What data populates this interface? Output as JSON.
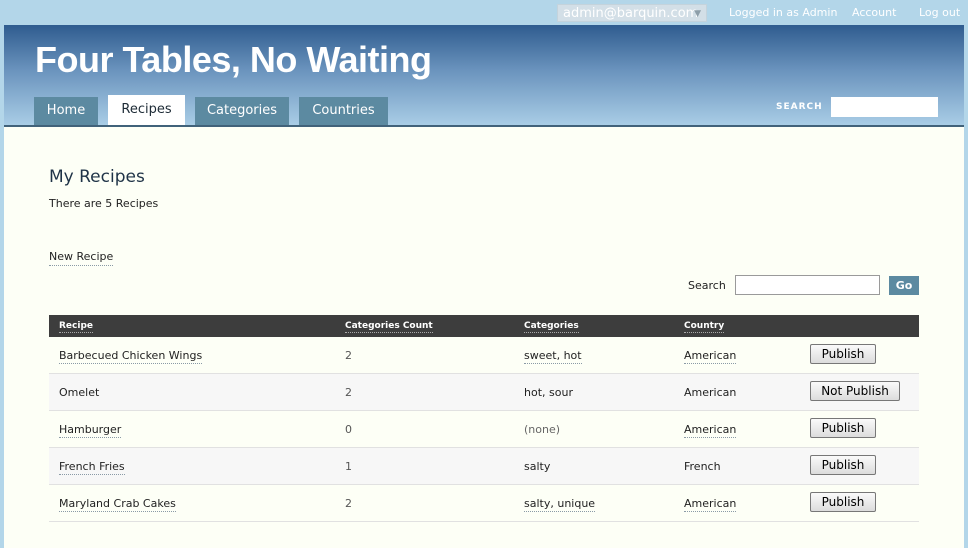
{
  "topbar": {
    "user_email": "admin@barquin.com",
    "status": "Logged in as Admin",
    "account": "Account",
    "logout": "Log out"
  },
  "header": {
    "site_title": "Four Tables, No Waiting",
    "tabs": [
      {
        "label": "Home",
        "active": false
      },
      {
        "label": "Recipes",
        "active": true
      },
      {
        "label": "Categories",
        "active": false
      },
      {
        "label": "Countries",
        "active": false
      }
    ],
    "search_label": "SEARCH"
  },
  "main": {
    "title": "My Recipes",
    "count_text": "There are 5 Recipes",
    "new_link": "New Recipe",
    "search_label": "Search",
    "go_label": "Go",
    "columns": [
      "Recipe",
      "Categories Count",
      "Categories",
      "Country"
    ],
    "rows": [
      {
        "recipe": "Barbecued Chicken Wings",
        "count": "2",
        "categories": "sweet, hot",
        "country": "American",
        "action": "Publish"
      },
      {
        "recipe": "Omelet",
        "count": "2",
        "categories": "hot, sour",
        "country": "American",
        "action": "Not Publish"
      },
      {
        "recipe": "Hamburger",
        "count": "0",
        "categories": "(none)",
        "country": "American",
        "action": "Publish"
      },
      {
        "recipe": "French Fries",
        "count": "1",
        "categories": "salty",
        "country": "French",
        "action": "Publish"
      },
      {
        "recipe": "Maryland Crab Cakes",
        "count": "2",
        "categories": "salty, unique",
        "country": "American",
        "action": "Publish"
      }
    ]
  },
  "colors": {
    "header_dark": "#2f5c8f",
    "tab": "#5c8aa1",
    "table_header": "#3d3d3d",
    "content_bg": "#fdfff6"
  }
}
